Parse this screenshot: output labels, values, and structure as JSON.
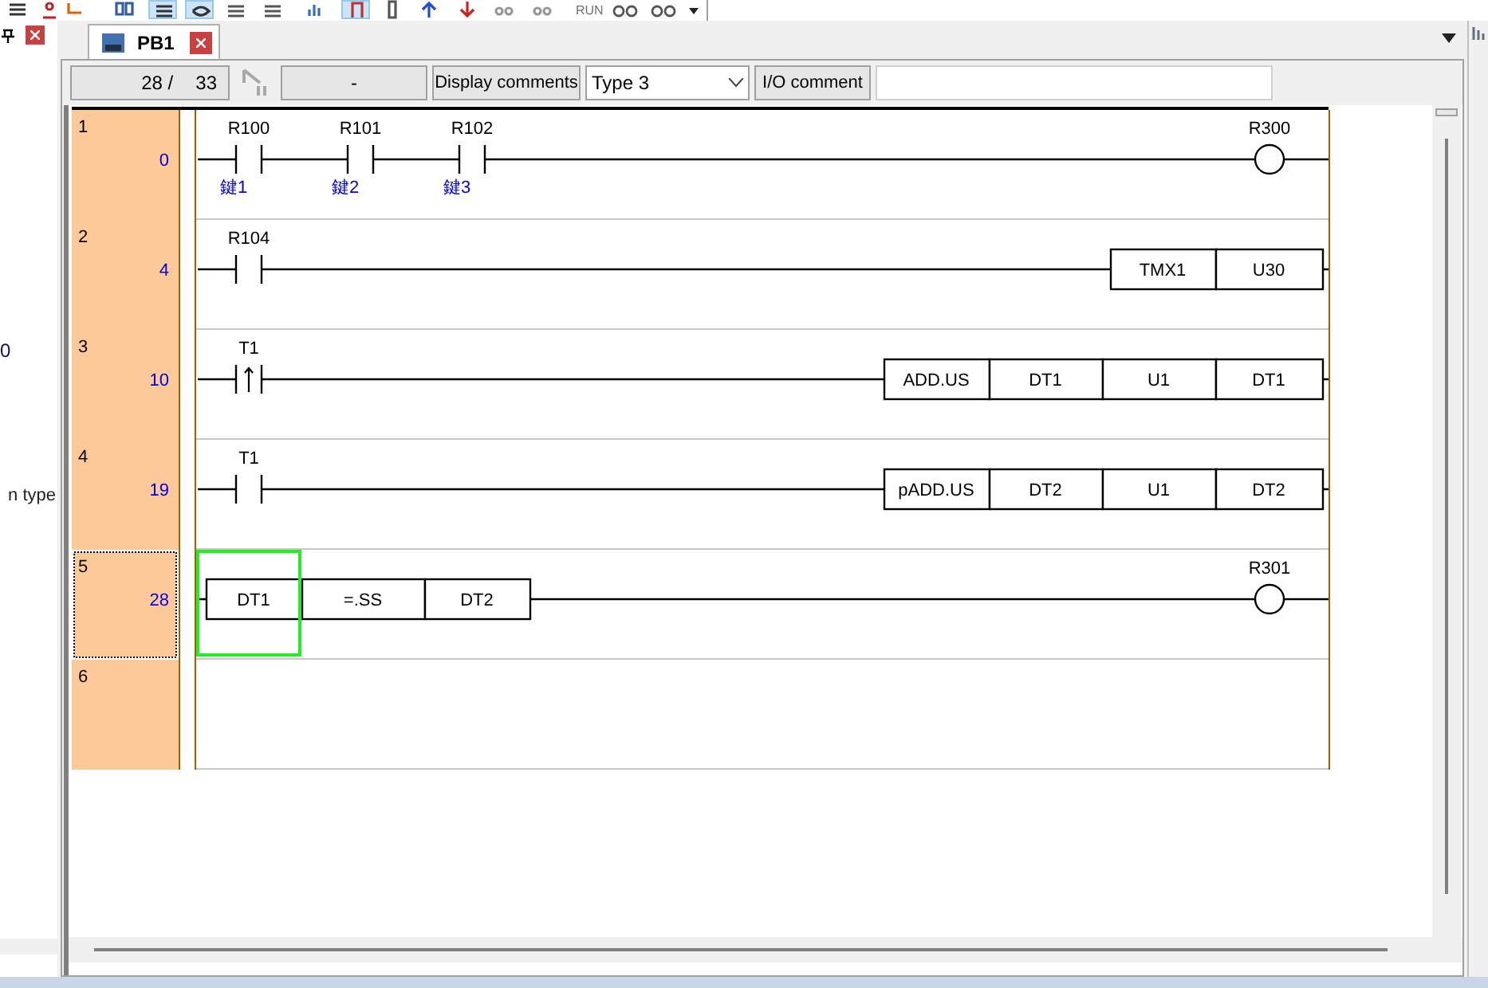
{
  "toolbar": {
    "run_label": "RUN"
  },
  "left_panel": {
    "cut_texts": [
      "0",
      "n type"
    ]
  },
  "tabs": [
    {
      "label": "PB1",
      "selected": true
    }
  ],
  "status": {
    "position": "28 /",
    "total": "33",
    "mode": "-",
    "display_label": "Display comments",
    "comment_type": "Type 3",
    "io_label": "I/O comment"
  },
  "rungs": [
    {
      "number": "1",
      "step": "0",
      "selected": false,
      "contacts": [
        {
          "kind": "normal",
          "address": "R100",
          "comment": "鍵1"
        },
        {
          "kind": "normal",
          "address": "R101",
          "comment": "鍵2"
        },
        {
          "kind": "normal",
          "address": "R102",
          "comment": "鍵3"
        }
      ],
      "coil": {
        "address": "R300"
      }
    },
    {
      "number": "2",
      "step": "4",
      "selected": false,
      "contacts": [
        {
          "kind": "normal",
          "address": "R104"
        }
      ],
      "box": {
        "kind": "instruction",
        "cells": [
          "TMX1",
          "U30"
        ]
      }
    },
    {
      "number": "3",
      "step": "10",
      "selected": false,
      "contacts": [
        {
          "kind": "rising",
          "address": "T1"
        }
      ],
      "box": {
        "kind": "instruction",
        "cells": [
          "ADD.US",
          "DT1",
          "U1",
          "DT1"
        ]
      }
    },
    {
      "number": "4",
      "step": "19",
      "selected": false,
      "contacts": [
        {
          "kind": "normal",
          "address": "T1"
        }
      ],
      "box": {
        "kind": "instruction",
        "cells": [
          "pADD.US",
          "DT2",
          "U1",
          "DT2"
        ]
      }
    },
    {
      "number": "5",
      "step": "28",
      "selected": true,
      "box": {
        "kind": "compare",
        "cells": [
          "DT1",
          "=.SS",
          "DT2"
        ]
      },
      "coil": {
        "address": "R301"
      }
    },
    {
      "number": "6",
      "selected": false
    }
  ]
}
